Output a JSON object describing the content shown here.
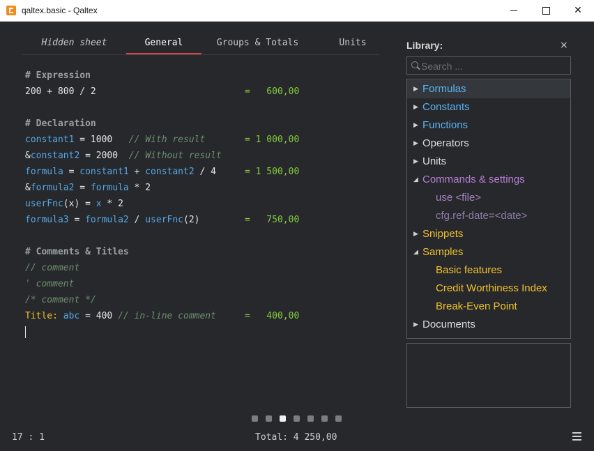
{
  "window": {
    "title": "qaltex.basic - Qaltex",
    "app_icon": "qaltex-app-icon",
    "minimize_glyph": "",
    "maximize_glyph": "",
    "close_glyph": "✕"
  },
  "tabs": [
    {
      "label": "Hidden sheet",
      "italic": true,
      "active": false
    },
    {
      "label": "General",
      "italic": false,
      "active": true
    },
    {
      "label": "Groups & Totals",
      "italic": false,
      "active": false
    },
    {
      "label": "Units",
      "italic": false,
      "active": false
    }
  ],
  "editor": {
    "lines": [
      {
        "segments": [
          {
            "t": "# Expression",
            "c": "hdr"
          }
        ]
      },
      {
        "segments": [
          {
            "t": "200 + 800 / 2",
            "c": "num"
          }
        ],
        "result": "=   600,00"
      },
      {
        "segments": []
      },
      {
        "segments": [
          {
            "t": "# Declaration",
            "c": "hdr"
          }
        ]
      },
      {
        "segments": [
          {
            "t": "constant1",
            "c": "var"
          },
          {
            "t": " = 1000   ",
            "c": "num"
          },
          {
            "t": "// With result",
            "c": "cmt"
          }
        ],
        "result": "= 1 000,00"
      },
      {
        "segments": [
          {
            "t": "&",
            "c": "num"
          },
          {
            "t": "constant2",
            "c": "var"
          },
          {
            "t": " = 2000  ",
            "c": "num"
          },
          {
            "t": "// Without result",
            "c": "cmt"
          }
        ]
      },
      {
        "segments": [
          {
            "t": "formula",
            "c": "var"
          },
          {
            "t": " = ",
            "c": "num"
          },
          {
            "t": "constant1",
            "c": "var"
          },
          {
            "t": " + ",
            "c": "num"
          },
          {
            "t": "constant2",
            "c": "var"
          },
          {
            "t": " / 4",
            "c": "num"
          }
        ],
        "result": "= 1 500,00"
      },
      {
        "segments": [
          {
            "t": "&",
            "c": "num"
          },
          {
            "t": "formula2",
            "c": "var"
          },
          {
            "t": " = ",
            "c": "num"
          },
          {
            "t": "formula",
            "c": "var"
          },
          {
            "t": " * 2",
            "c": "num"
          }
        ]
      },
      {
        "segments": [
          {
            "t": "userFnc",
            "c": "var"
          },
          {
            "t": "(x) = ",
            "c": "num"
          },
          {
            "t": "x",
            "c": "var"
          },
          {
            "t": " * 2",
            "c": "num"
          }
        ]
      },
      {
        "segments": [
          {
            "t": "formula3",
            "c": "var"
          },
          {
            "t": " = ",
            "c": "num"
          },
          {
            "t": "formula2",
            "c": "var"
          },
          {
            "t": " / ",
            "c": "num"
          },
          {
            "t": "userFnc",
            "c": "var"
          },
          {
            "t": "(2)",
            "c": "num"
          }
        ],
        "result": "=   750,00"
      },
      {
        "segments": []
      },
      {
        "segments": [
          {
            "t": "# Comments & Titles",
            "c": "hdr"
          }
        ]
      },
      {
        "segments": [
          {
            "t": "// comment",
            "c": "cmt"
          }
        ]
      },
      {
        "segments": [
          {
            "t": "' comment",
            "c": "cmt"
          }
        ]
      },
      {
        "segments": [
          {
            "t": "/* comment */",
            "c": "cmt"
          }
        ]
      },
      {
        "segments": [
          {
            "t": "Title:",
            "c": "lbl"
          },
          {
            "t": " ",
            "c": "num"
          },
          {
            "t": "abc",
            "c": "var"
          },
          {
            "t": " = 400 ",
            "c": "num"
          },
          {
            "t": "// in-line comment",
            "c": "cmt"
          }
        ],
        "result": "=   400,00"
      },
      {
        "segments": [],
        "caret": true
      }
    ]
  },
  "library": {
    "title": "Library:",
    "close_glyph": "×",
    "search_placeholder": "Search ...",
    "search_value": "",
    "items": [
      {
        "label": "Formulas",
        "arrow": "▶",
        "color": "c-blue",
        "child": false,
        "selected": true
      },
      {
        "label": "Constants",
        "arrow": "▶",
        "color": "c-blue",
        "child": false
      },
      {
        "label": "Functions",
        "arrow": "▶",
        "color": "c-blue",
        "child": false
      },
      {
        "label": "Operators",
        "arrow": "▶",
        "color": "c-white",
        "child": false
      },
      {
        "label": "Units",
        "arrow": "▶",
        "color": "c-white",
        "child": false
      },
      {
        "label": "Commands & settings",
        "arrow": "◢",
        "color": "c-purple",
        "child": false
      },
      {
        "label": "use <file>",
        "arrow": "",
        "color": "c-purple-dim",
        "child": true
      },
      {
        "label": "cfg.ref-date=<date>",
        "arrow": "",
        "color": "c-gray-purple",
        "child": true
      },
      {
        "label": "Snippets",
        "arrow": "▶",
        "color": "c-yellow",
        "child": false
      },
      {
        "label": "Samples",
        "arrow": "◢",
        "color": "c-yellow",
        "child": false
      },
      {
        "label": "Basic features",
        "arrow": "",
        "color": "c-yellow",
        "child": true
      },
      {
        "label": "Credit Worthiness Index",
        "arrow": "",
        "color": "c-yellow",
        "child": true
      },
      {
        "label": "Break-Even Point",
        "arrow": "",
        "color": "c-yellow",
        "child": true
      },
      {
        "label": "Documents",
        "arrow": "▶",
        "color": "c-white",
        "child": false
      }
    ]
  },
  "pager": {
    "count": 7,
    "active_index": 2
  },
  "status": {
    "position": "17 : 1",
    "total": "Total: 4 250,00",
    "menu_icon": "hamburger-menu-icon"
  },
  "colors": {
    "background": "#26282c",
    "accent": "#d9474a",
    "variable": "#57a8e6",
    "result": "#86cc3c",
    "comment": "#6e8f6e",
    "title": "#f2c12e"
  }
}
